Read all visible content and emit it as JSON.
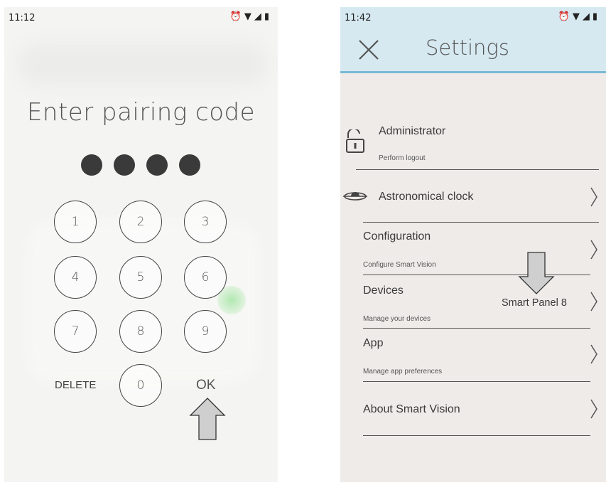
{
  "left_screen": {
    "status_time": "11:12",
    "status_icons": [
      "alarm-icon",
      "wifi-icon",
      "signal-icon",
      "battery-icon"
    ],
    "title": "Enter pairing code",
    "pin_dots": 4,
    "keys": [
      "1",
      "2",
      "3",
      "4",
      "5",
      "6",
      "7",
      "8",
      "9",
      "0"
    ],
    "delete_label": "DELETE",
    "ok_label": "OK"
  },
  "right_screen": {
    "status_time": "11:42",
    "status_icons": [
      "alarm-icon",
      "wifi-icon",
      "signal-icon",
      "battery-icon"
    ],
    "header_title": "Settings",
    "rows": {
      "administrator": {
        "title": "Administrator",
        "subtitle": "Perform logout",
        "icon": "lock-icon"
      },
      "astronomical": {
        "title": "Astronomical clock",
        "icon": "astronomical-clock-icon"
      },
      "configuration": {
        "title": "Configuration",
        "subtitle": "Configure Smart Vision"
      },
      "devices": {
        "title": "Devices",
        "subtitle": "Manage your devices",
        "value": "Smart Panel 8"
      },
      "app": {
        "title": "App",
        "subtitle": "Manage app preferences"
      },
      "about": {
        "title": "About Smart Vision"
      }
    }
  },
  "colors": {
    "header_bg": "#d6e9f1",
    "header_border": "#7ab9d6",
    "arrow_fill": "#cfcfcf"
  }
}
